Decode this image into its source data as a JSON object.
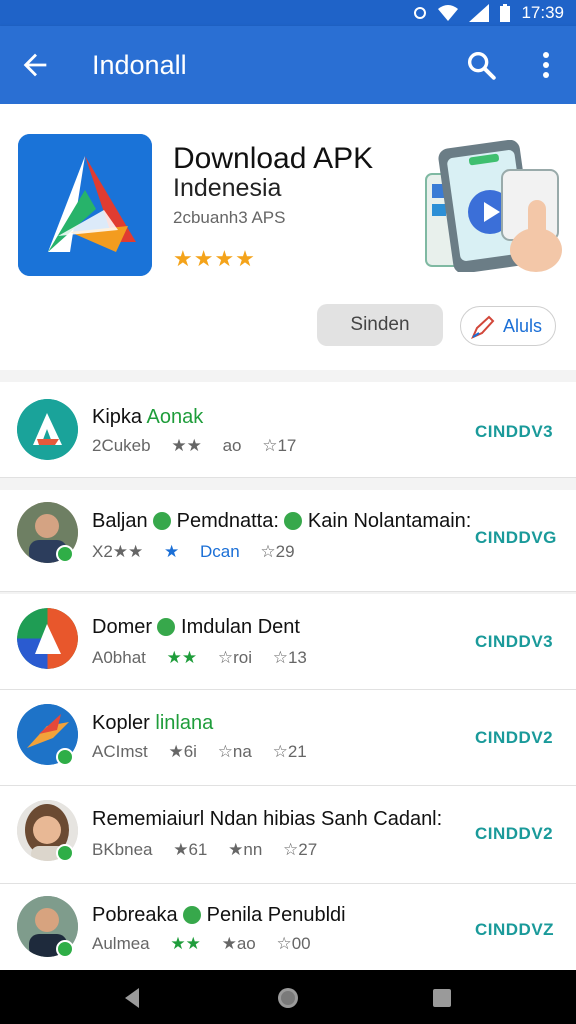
{
  "status": {
    "time": "17:39"
  },
  "appbar": {
    "title": "Indonall"
  },
  "hero": {
    "title": "Download APK",
    "subtitle": "Indenesia",
    "meta": "2cbuanh3 APS",
    "stars": "★★★★",
    "btn_primary": "Sinden",
    "btn_secondary": "Aluls"
  },
  "rows": [
    {
      "name_a": "Kipka",
      "name_b": "Aonak",
      "meta": [
        "2Cukeb",
        "★★",
        "ao",
        "☆17"
      ],
      "action": "CINDDV3"
    },
    {
      "name_a": "Baljan",
      "name_b": "Pemdnatta:",
      "name_c": "Kain Nolantamain:",
      "meta": [
        "X2★★",
        "★",
        "Dcan",
        "☆29"
      ],
      "action": "CINDDVG"
    },
    {
      "name_a": "Domer",
      "name_b": "Imdulan Dent",
      "meta": [
        "A0bhat",
        "★★",
        "☆roi",
        "☆13"
      ],
      "action": "CINDDV3"
    },
    {
      "name_a": "Kopler",
      "name_b": "linlana",
      "meta": [
        "ACImst",
        "★6i",
        "☆na",
        "☆21"
      ],
      "action": "CINDDV2"
    },
    {
      "name_a": "Rememiaiurl Ndan hibias Sanh Cadanl:",
      "meta": [
        "BKbnea",
        "★61",
        "★nn",
        "☆27"
      ],
      "action": "CINDDV2"
    },
    {
      "name_a": "Pobreaka",
      "name_b": "Penila Penubldi",
      "meta": [
        "Aulmea",
        "★★",
        "★ao",
        "☆00"
      ],
      "action": "CINDDVZ"
    }
  ],
  "colors": {
    "appbar": "#2a6fd3",
    "accent_teal": "#1a9a9a",
    "star": "#f4a31a",
    "verified": "#37a84b"
  },
  "icons": [
    "back-arrow-icon",
    "search-icon",
    "more-vert-icon",
    "wifi-icon",
    "signal-icon",
    "battery-icon",
    "star-icon",
    "verified-icon",
    "pen-icon",
    "nav-back-icon",
    "nav-home-icon",
    "nav-recents-icon"
  ]
}
